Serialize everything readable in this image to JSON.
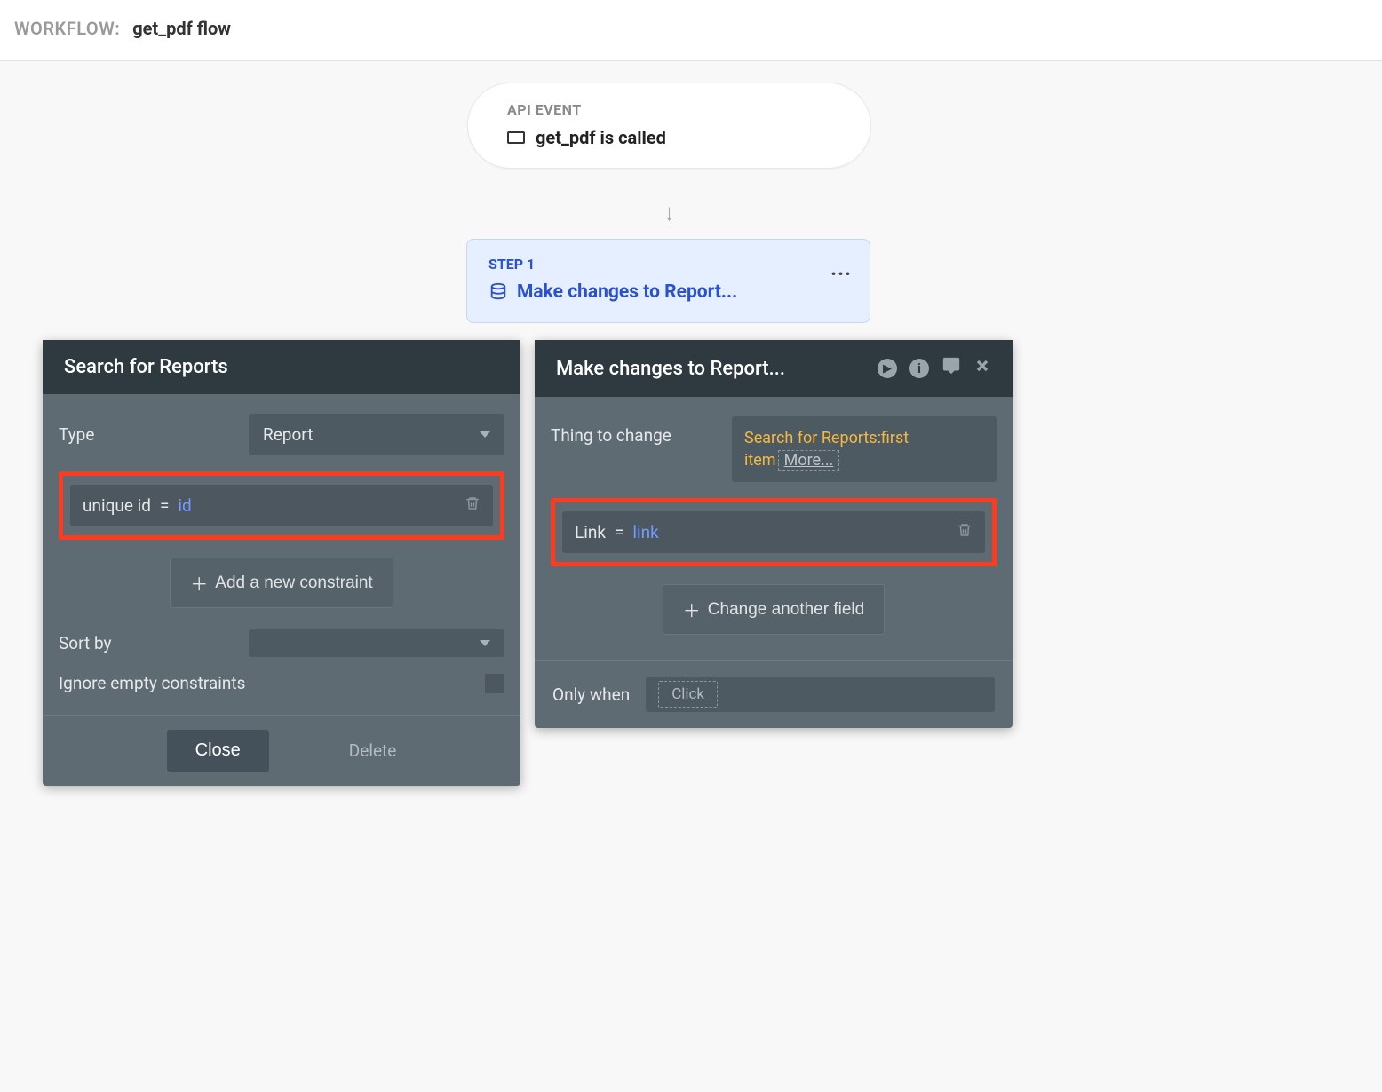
{
  "header": {
    "label": "WORKFLOW:",
    "title": "get_pdf flow"
  },
  "event": {
    "label": "API EVENT",
    "text": "get_pdf is called"
  },
  "step": {
    "label": "STEP 1",
    "title": "Make changes to Report..."
  },
  "search_panel": {
    "title": "Search for Reports",
    "type_label": "Type",
    "type_value": "Report",
    "constraint_key": "unique id",
    "constraint_eq": "=",
    "constraint_val": "id",
    "add_constraint": "Add a new constraint",
    "sort_by_label": "Sort by",
    "ignore_label": "Ignore empty constraints",
    "close": "Close",
    "delete": "Delete"
  },
  "changes_panel": {
    "title": "Make changes to Report...",
    "thing_label": "Thing to change",
    "thing_value": "Search for Reports:first item",
    "more": "More...",
    "field_key": "Link",
    "field_eq": "=",
    "field_val": "link",
    "change_another": "Change another field",
    "only_when_label": "Only when",
    "click_chip": "Click"
  }
}
